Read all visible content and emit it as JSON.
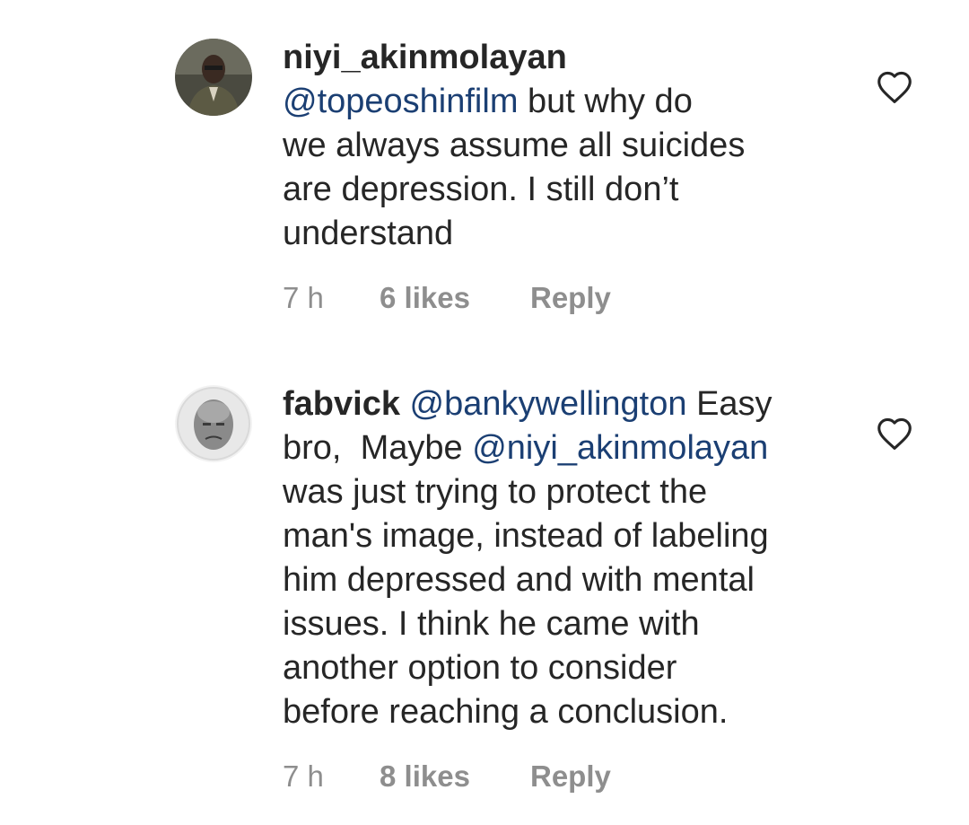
{
  "comments": [
    {
      "username": "niyi_akinmolayan",
      "segments": [
        {
          "text": "@topeoshinfilm",
          "type": "mention"
        },
        {
          "text": " but why do",
          "type": "text"
        },
        {
          "text": "we always assume all suicides",
          "type": "text"
        },
        {
          "text": "are depression. I still don’t",
          "type": "text"
        },
        {
          "text": "understand",
          "type": "text"
        }
      ],
      "time": "7 h",
      "likes": "6 likes",
      "reply": "Reply",
      "avatar_icon": "profile-photo-man-in-suit",
      "like_icon": "heart-outline-icon"
    },
    {
      "username": "fabvick",
      "segments": [
        {
          "text": "@bankywellington",
          "type": "mention"
        },
        {
          "text": " Easy",
          "type": "text"
        },
        {
          "text": "bro,  Maybe ",
          "type": "text"
        },
        {
          "text": "@niyi_akinmolayan",
          "type": "mention"
        },
        {
          "text": "was just trying to protect the",
          "type": "text"
        },
        {
          "text": "man's image, instead of labeling",
          "type": "text"
        },
        {
          "text": "him depressed and with mental",
          "type": "text"
        },
        {
          "text": "issues. I think he came with",
          "type": "text"
        },
        {
          "text": "another option to consider",
          "type": "text"
        },
        {
          "text": "before reaching a conclusion.",
          "type": "text"
        }
      ],
      "time": "7 h",
      "likes": "8 likes",
      "reply": "Reply",
      "avatar_icon": "profile-photo-bald-man-grayscale",
      "like_icon": "heart-outline-icon"
    }
  ],
  "colors": {
    "text": "#262626",
    "mention": "#1b3f73",
    "meta": "#8e8e8e",
    "background": "#ffffff"
  }
}
